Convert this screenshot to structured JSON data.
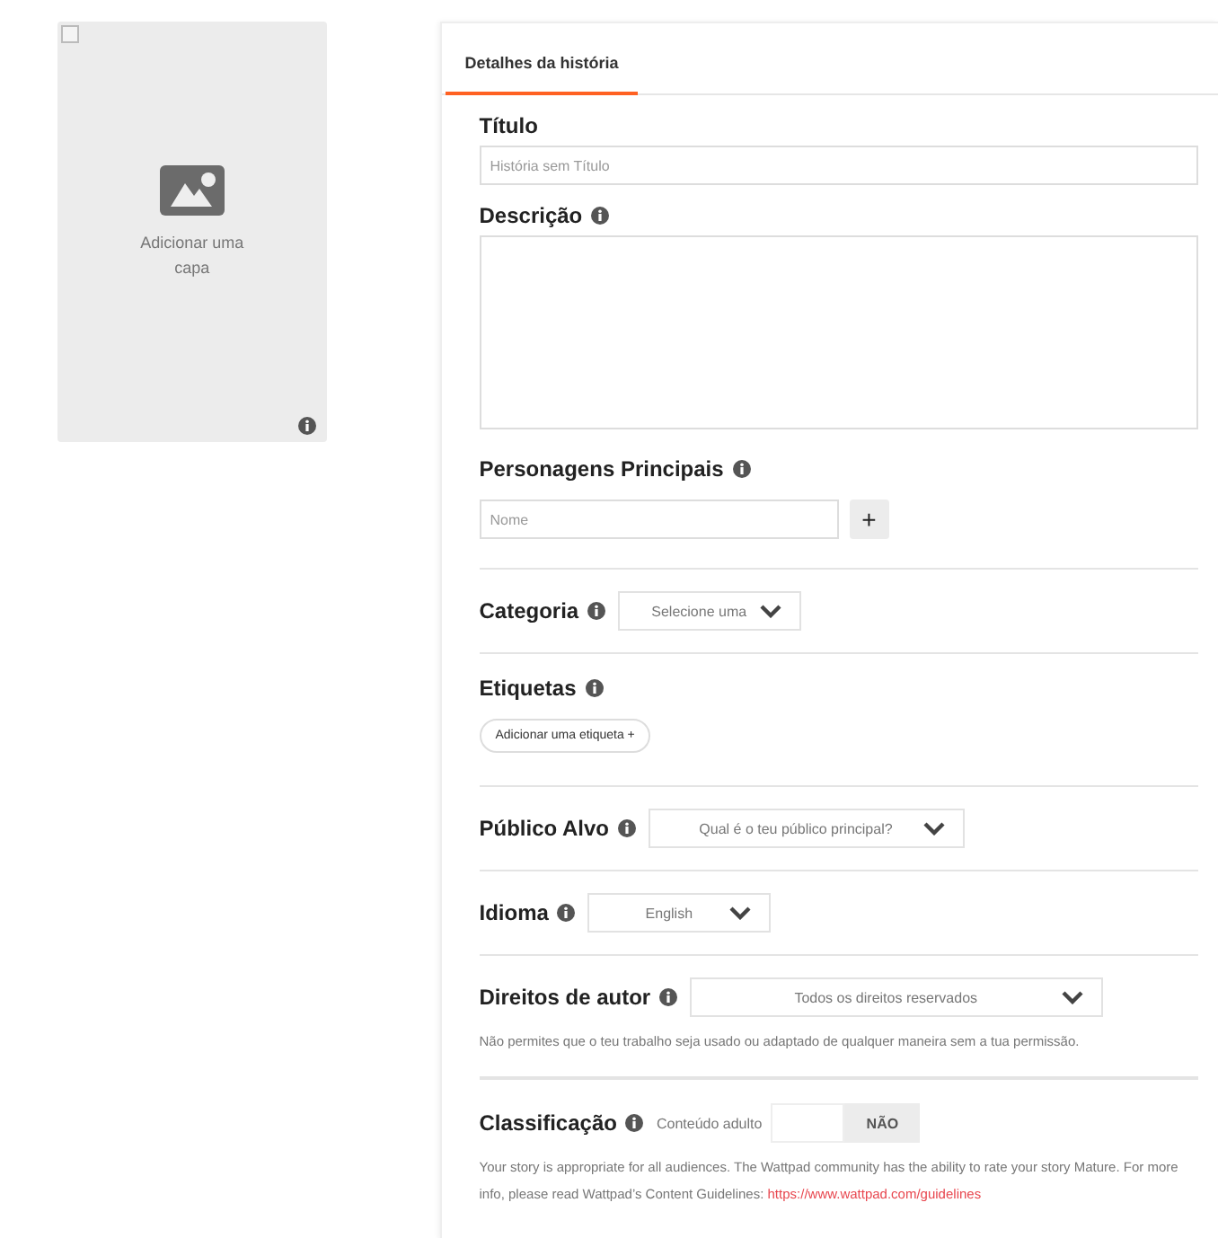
{
  "cover": {
    "checked": false,
    "label": "Adicionar uma capa"
  },
  "tabs": [
    {
      "label": "Detalhes da história",
      "selected": true
    }
  ],
  "fields": [
    {
      "kind": "text",
      "label": "Título",
      "info": false,
      "placeholder": "História sem Título"
    },
    {
      "kind": "textarea",
      "label": "Descrição",
      "info": true
    },
    {
      "kind": "character",
      "label": "Personagens Principais",
      "info": true,
      "placeholder": "Nome",
      "button": "+"
    },
    {
      "kind": "select",
      "label": "Categoria",
      "info": true,
      "value": "Selecione uma"
    },
    {
      "kind": "tag",
      "label": "Etiquetas",
      "info": true,
      "button": "Adicionar uma etiqueta +"
    },
    {
      "kind": "select",
      "label": "Público Alvo",
      "info": true,
      "value": "Qual é o teu público principal?"
    },
    {
      "kind": "select",
      "label": "Idioma",
      "info": true,
      "value": "English"
    },
    {
      "kind": "select",
      "label": "Direitos de autor",
      "info": true,
      "value": "Todos os direitos reservados",
      "note": "Não permites que o teu trabalho seja usado ou adaptado de qualquer maneira sem a tua permissão."
    },
    {
      "kind": "toggle",
      "label": "Classificação",
      "info": true,
      "toggle_label": "Conteúdo adulto",
      "state_text": "NÃO",
      "on": false,
      "note": "Your story is appropriate for all audiences. The Wattpad community has the ability to rate your story Mature. For more info, please read Wattpad’s Content Guidelines: ",
      "link": "https://www.wattpad.com/guidelines"
    }
  ]
}
